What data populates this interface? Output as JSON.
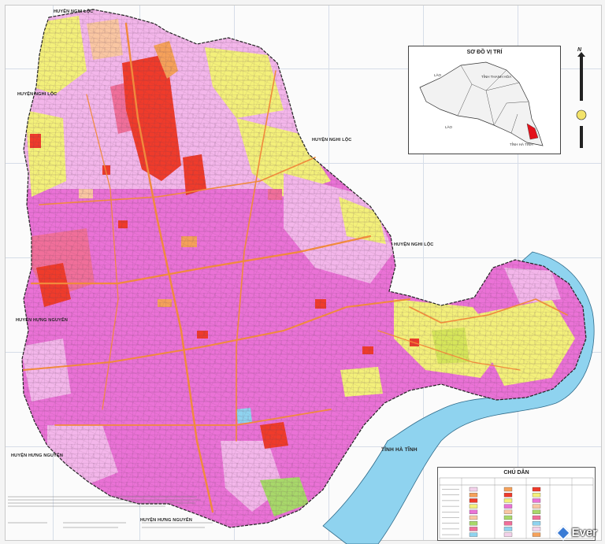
{
  "map": {
    "neighbors": {
      "north": "HUYỆN NGHI LỘC",
      "northwest": "HUYỆN NGHI LỘC",
      "northeast": "HUYỆN NGHI LỘC",
      "east": "HUYỆN NGHI LỘC",
      "west1": "HUYỆN HƯNG NGUYÊN",
      "west2": "HUYỆN HƯNG NGUYÊN",
      "south": "HUYỆN HƯNG NGUYÊN",
      "southeast": "TỈNH HÀ TĨNH"
    },
    "colors": {
      "residential": "#ea72d6",
      "residential_light": "#f3b6ea",
      "urban_core": "#f06f9a",
      "commercial": "#ef3b2b",
      "mixed": "#f5a15a",
      "agricultural": "#f3f07a",
      "yellow_green": "#d6e65a",
      "green": "#a8d86a",
      "water": "#8fd3ef",
      "road": "#f08a3c",
      "boundary": "#222222"
    }
  },
  "inset": {
    "title": "SƠ ĐỒ VỊ TRÍ",
    "labels": {
      "laos_top": "LÀO",
      "laos_bottom": "LÀO",
      "thanh_hoa": "TỈNH THANH HÓA",
      "ha_tinh": "TỈNH HÀ TĨNH"
    }
  },
  "compass": {
    "north": "N"
  },
  "legend": {
    "title": "CHÚ DẪN",
    "swatches": [
      "#f3d1ea",
      "#f5a15a",
      "#ef3b2b",
      "#f3f07a",
      "#ea72d6",
      "#f9c6a2",
      "#a8d86a",
      "#f06f9a",
      "#8fd3ef"
    ]
  },
  "watermark": {
    "text": "Ever"
  }
}
